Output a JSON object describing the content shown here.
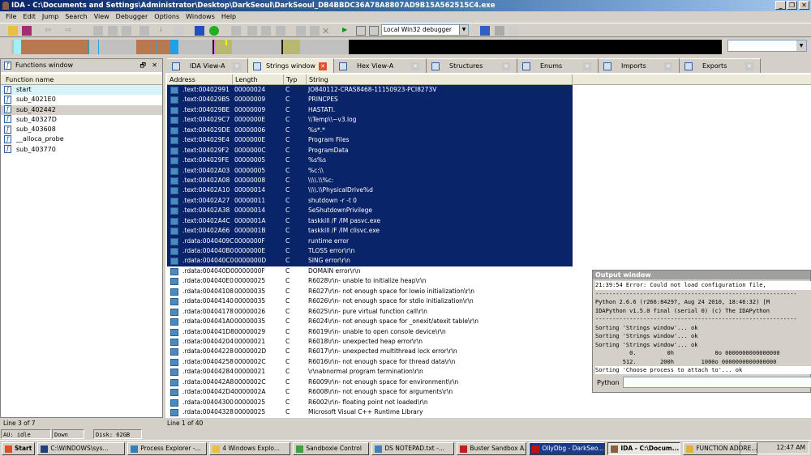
{
  "title": "IDA - C:\\Documents and Settings\\Administrator\\Desktop\\DarkSeoul\\DarkSeoul_DB4BBDC36A78A8807AD9B15A562515C4.exe",
  "menu": [
    "File",
    "Edit",
    "Jump",
    "Search",
    "View",
    "Debugger",
    "Options",
    "Windows",
    "Help"
  ],
  "debugger_select": "Local Win32 debugger",
  "functions_window": {
    "title": "Functions window",
    "column": "Function name",
    "items": [
      "start",
      "sub_4021E0",
      "sub_402442",
      "sub_40327D",
      "sub_403608",
      "__alloca_probe",
      "sub_403770"
    ],
    "status": "Line 3 of 7"
  },
  "tabs": [
    "IDA View-A",
    "Strings window",
    "Hex View-A",
    "Structures",
    "Enums",
    "Imports",
    "Exports"
  ],
  "strings_window": {
    "columns": [
      "Address",
      "Length",
      "Typ",
      "String"
    ],
    "status": "Line 1 of 40",
    "rows": [
      [
        ".text:00402991",
        "00000024",
        "C",
        "JO840112-CRAS8468-11150923-PCI8273V"
      ],
      [
        ".text:004029B5",
        "00000009",
        "C",
        "PRINCPES"
      ],
      [
        ".text:004029BE",
        "00000009",
        "C",
        "HASTATI."
      ],
      [
        ".text:004029C7",
        "0000000E",
        "C",
        "\\\\Temp\\\\~v3.log"
      ],
      [
        ".text:004029DE",
        "00000006",
        "C",
        "%s*.*"
      ],
      [
        ".text:004029E4",
        "0000000E",
        "C",
        "Program Files"
      ],
      [
        ".text:004029F2",
        "0000000C",
        "C",
        "ProgramData"
      ],
      [
        ".text:004029FE",
        "00000005",
        "C",
        "%s%s"
      ],
      [
        ".text:00402A03",
        "00000005",
        "C",
        "%c:\\\\"
      ],
      [
        ".text:00402A08",
        "00000008",
        "C",
        "\\\\\\\\.\\\\%c:"
      ],
      [
        ".text:00402A10",
        "00000014",
        "C",
        "\\\\\\\\.\\\\PhysicalDrive%d"
      ],
      [
        ".text:00402A27",
        "00000011",
        "C",
        "shutdown -r -t 0"
      ],
      [
        ".text:00402A38",
        "00000014",
        "C",
        "SeShutdownPrivilege"
      ],
      [
        ".text:00402A4C",
        "0000001A",
        "C",
        "taskkill /F /IM pasvc.exe"
      ],
      [
        ".text:00402A66",
        "0000001B",
        "C",
        "taskkill /F /IM clisvc.exe"
      ],
      [
        ".rdata:0040409C",
        "0000000F",
        "C",
        "runtime error"
      ],
      [
        ".rdata:004040B0",
        "0000000E",
        "C",
        "TLOSS error\\r\\n"
      ],
      [
        ".rdata:004040C0",
        "0000000D",
        "C",
        "SING error\\r\\n"
      ],
      [
        ".rdata:004040D0",
        "0000000F",
        "C",
        "DOMAIN error\\r\\n"
      ],
      [
        ".rdata:004040E0",
        "00000025",
        "C",
        "R6028\\r\\n- unable to initialize heap\\r\\n"
      ],
      [
        ".rdata:00404108",
        "00000035",
        "C",
        "R6027\\r\\n- not enough space for lowio initialization\\r\\n"
      ],
      [
        ".rdata:00404140",
        "00000035",
        "C",
        "R6026\\r\\n- not enough space for stdio initialization\\r\\n"
      ],
      [
        ".rdata:00404178",
        "00000026",
        "C",
        "R6025\\r\\n- pure virtual function call\\r\\n"
      ],
      [
        ".rdata:004041A0",
        "00000035",
        "C",
        "R6024\\r\\n- not enough space for _onexit/atexit table\\r\\n"
      ],
      [
        ".rdata:004041D8",
        "00000029",
        "C",
        "R6019\\r\\n- unable to open console device\\r\\n"
      ],
      [
        ".rdata:00404204",
        "00000021",
        "C",
        "R6018\\r\\n- unexpected heap error\\r\\n"
      ],
      [
        ".rdata:00404228",
        "0000002D",
        "C",
        "R6017\\r\\n- unexpected multithread lock error\\r\\n"
      ],
      [
        ".rdata:00404258",
        "0000002C",
        "C",
        "R6016\\r\\n- not enough space for thread data\\r\\n"
      ],
      [
        ".rdata:00404284",
        "00000021",
        "C",
        "\\r\\nabnormal program termination\\r\\n"
      ],
      [
        ".rdata:004042A8",
        "0000002C",
        "C",
        "R6009\\r\\n- not enough space for environment\\r\\n"
      ],
      [
        ".rdata:004042D4",
        "0000002A",
        "C",
        "R6008\\r\\n- not enough space for arguments\\r\\n"
      ],
      [
        ".rdata:00404300",
        "00000025",
        "C",
        "R6002\\r\\n- floating point not loaded\\r\\n"
      ],
      [
        ".rdata:00404328",
        "00000025",
        "C",
        "Microsoft Visual C++ Runtime Library"
      ]
    ]
  },
  "output_window": {
    "title": "Output window",
    "lines": [
      "21:39:54 Error: Could not load configuration file, ",
      "-----------------------------------------------------------",
      "Python 2.6.6 (r266:84297, Aug 24 2010, 18:46:32) [M",
      "IDAPython v1.5.0 final (serial 0) (c) The IDAPython",
      "-----------------------------------------------------------",
      "Sorting 'Strings window'... ok",
      "Sorting 'Strings window'... ok",
      "Sorting 'Strings window'... ok",
      "          0.         0h            0o 0000000000000000",
      "        512.       200h        1000o 0000000000000000",
      "Sorting 'Choose process to attach to'... ok"
    ],
    "python_label": "Python"
  },
  "au_status": {
    "au": "AU:  idle",
    "dir": "Down",
    "disk": "Disk: 62GB"
  },
  "taskbar": {
    "start": "Start",
    "items": [
      "C:\\WINDOWS\\sys...",
      "Process Explorer -...",
      "4 Windows Explo...",
      "Sandboxie Control",
      "DS NOTEPAD.txt -...",
      "Buster Sandbox A...",
      "OllyDbg - DarkSeo...",
      "IDA - C:\\Docum...",
      "FUNCTION ADDRE..."
    ],
    "clock": "12:47 AM"
  }
}
